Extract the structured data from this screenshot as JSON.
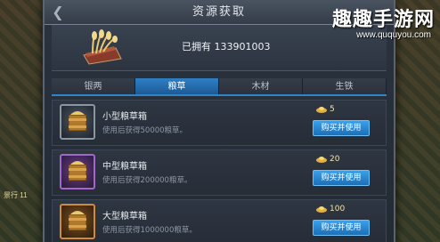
{
  "window": {
    "title": "资源获取"
  },
  "header": {
    "owned_label": "已拥有",
    "owned_value": "133901003"
  },
  "tabs": [
    {
      "label": "银两",
      "active": false
    },
    {
      "label": "粮草",
      "active": true
    },
    {
      "label": "木材",
      "active": false
    },
    {
      "label": "生铁",
      "active": false
    }
  ],
  "items": [
    {
      "name": "小型粮草箱",
      "desc": "使用后获得50000粮草。",
      "price": "5",
      "button": "购买并使用",
      "rarity": "gray"
    },
    {
      "name": "中型粮草箱",
      "desc": "使用后获得200000粮草。",
      "price": "20",
      "button": "购买并使用",
      "rarity": "purple"
    },
    {
      "name": "大型粮草箱",
      "desc": "使用后获得1000000粮草。",
      "price": "100",
      "button": "购买并使用",
      "rarity": "orange"
    }
  ],
  "background": {
    "tag": "景行 11"
  },
  "watermark": {
    "title": "趣趣手游网",
    "url": "www.ququyou.com"
  },
  "colors": {
    "accent": "#2e86c9",
    "button": "#1c6fb8",
    "price": "#f0e2b0"
  }
}
